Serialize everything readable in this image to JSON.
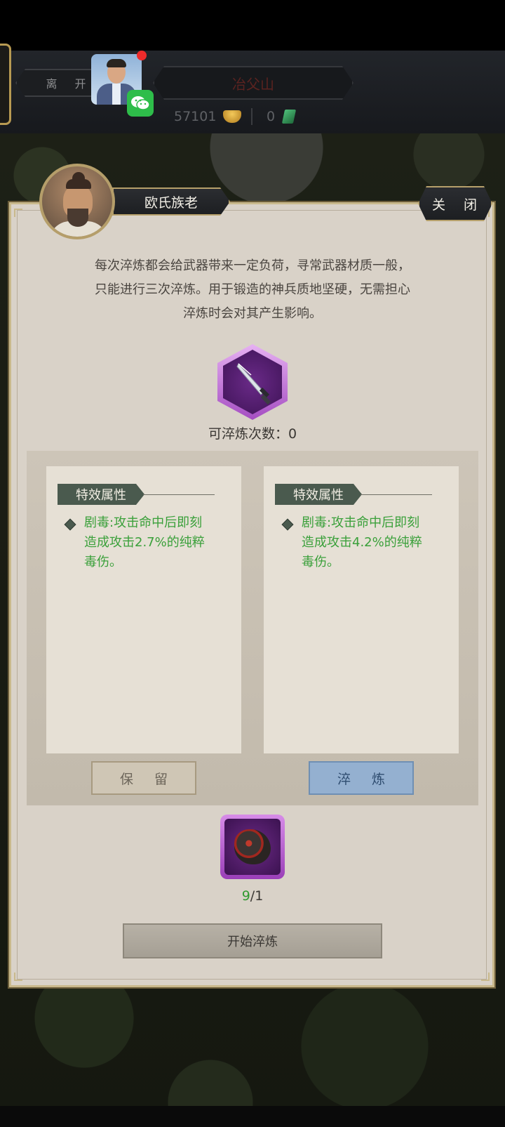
{
  "header": {
    "leave_label": "离 开",
    "location": "冶父山",
    "gold_amount": "57101",
    "jade_amount": "0",
    "separator": "|"
  },
  "dialog": {
    "npc_name": "欧氏族老",
    "close_label": "关 闭",
    "description_lines": [
      "每次淬炼都会给武器带来一定负荷，寻常武器材质一般，",
      "只能进行三次淬炼。用于锻造的神兵质地坚硬，无需担心",
      "淬炼时会对其产生影响。"
    ],
    "refine_count_label": "可淬炼次数：",
    "refine_count_value": "0",
    "left_card": {
      "tag": "特效属性",
      "effect_lines": [
        "剧毒:攻击命中后即刻",
        "造成攻击2.7%的纯粹",
        "毒伤。"
      ]
    },
    "right_card": {
      "tag": "特效属性",
      "effect_lines": [
        "剧毒:攻击命中后即刻",
        "造成攻击4.2%的纯粹",
        "毒伤。"
      ]
    },
    "keep_label": "保 留",
    "refine_label": "淬 炼",
    "material_have": "9",
    "material_need": "/1",
    "start_label": "开始淬炼"
  },
  "icons": {
    "weapon": "dagger-icon",
    "material": "ore-icon",
    "gold": "gold-ingot-icon",
    "jade": "jade-icon",
    "wechat": "wechat-icon"
  },
  "colors": {
    "effect_text": "#3aa03a",
    "rarity_purple": "#a54ec2",
    "refine_button": "#94b0d0"
  }
}
